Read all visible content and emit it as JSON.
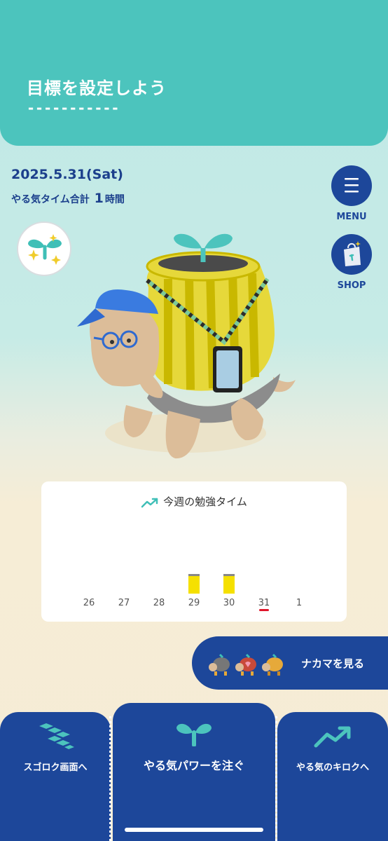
{
  "header": {
    "goal_title": "目標を設定しよう",
    "goal_dashes": "-----------",
    "accent": "#4cc4bd"
  },
  "status": {
    "date": "2025.5.31(Sat)",
    "total_prefix": "やる気タイム合計",
    "total_value": "1",
    "total_unit": "時間"
  },
  "side_buttons": {
    "menu_label": "MENU",
    "shop_label": "SHOP"
  },
  "icons": {
    "menu": "hamburger-icon",
    "shop": "shopping-bag-icon",
    "badge": "sprout-sparkle-icon"
  },
  "weekly_card": {
    "title": "今週の勉強タイム"
  },
  "chart_data": {
    "type": "bar",
    "categories": [
      "26",
      "27",
      "28",
      "29",
      "30",
      "31",
      "1"
    ],
    "values": [
      0,
      0,
      0,
      1,
      1,
      0,
      0
    ],
    "highlight_category": "31",
    "bar_color": "#f5e000",
    "ylim": [
      0,
      4
    ]
  },
  "nakama": {
    "label": "ナカマを見る"
  },
  "nav": {
    "left_label": "スゴロク画面へ",
    "center_label": "やる気パワーを注ぐ",
    "right_label": "やる気のキロクへ",
    "color": "#1d479a"
  }
}
